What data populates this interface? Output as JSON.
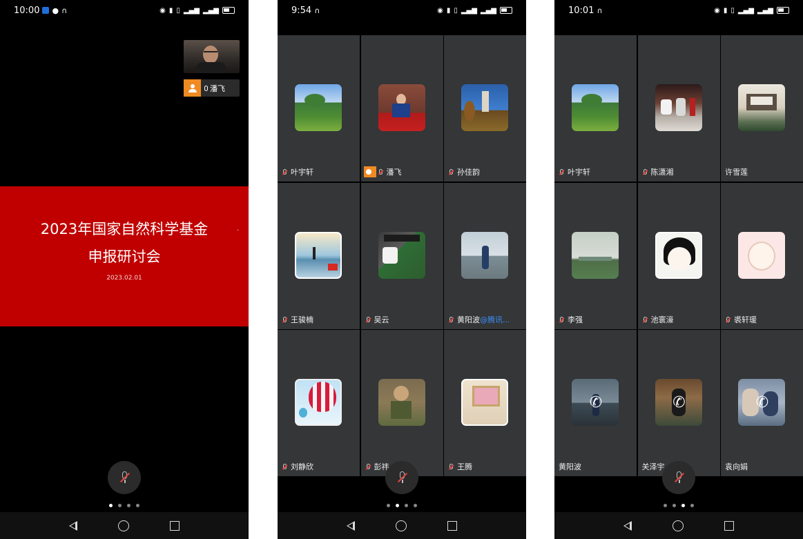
{
  "phone1": {
    "status": {
      "time": "10:00"
    },
    "self_view": {
      "name": "潘飞"
    },
    "slide": {
      "title_line1": "2023年国家自然科学基金",
      "title_line2": "申报研讨会",
      "date": "2023.02.01",
      "dot": "."
    }
  },
  "phone2": {
    "status": {
      "time": "9:54"
    },
    "participants": [
      {
        "name": "叶宇轩"
      },
      {
        "name": "潘飞"
      },
      {
        "name": "孙佳韵"
      },
      {
        "name": "王骏楠"
      },
      {
        "name": "吴云"
      },
      {
        "name": "黄阳波",
        "suffix": "@腾讯..."
      },
      {
        "name": "刘静欣"
      },
      {
        "name": "彭祎"
      },
      {
        "name": "王腾"
      }
    ]
  },
  "phone3": {
    "status": {
      "time": "10:01"
    },
    "participants": [
      {
        "name": "叶宇轩"
      },
      {
        "name": "陈潇湘"
      },
      {
        "name": "许雪莲"
      },
      {
        "name": "李强"
      },
      {
        "name": "池寰濠"
      },
      {
        "name": "裘轩瑗"
      },
      {
        "name": "黄阳波"
      },
      {
        "name": "关泽宇"
      },
      {
        "name": "袁向娟"
      }
    ]
  },
  "status_icons": [
    "eye-icon",
    "mic-icon",
    "vibrate-icon",
    "signal-icon",
    "signal-icon",
    "battery-icon"
  ],
  "colors": {
    "slide_red": "#c00000",
    "accent_orange": "#f08a23",
    "mention_blue": "#3d8ef8",
    "tile_bg": "#343638"
  },
  "pager": {
    "phone1_active": 0,
    "phone2_active": 1,
    "phone3_active": 2,
    "count": 4
  }
}
